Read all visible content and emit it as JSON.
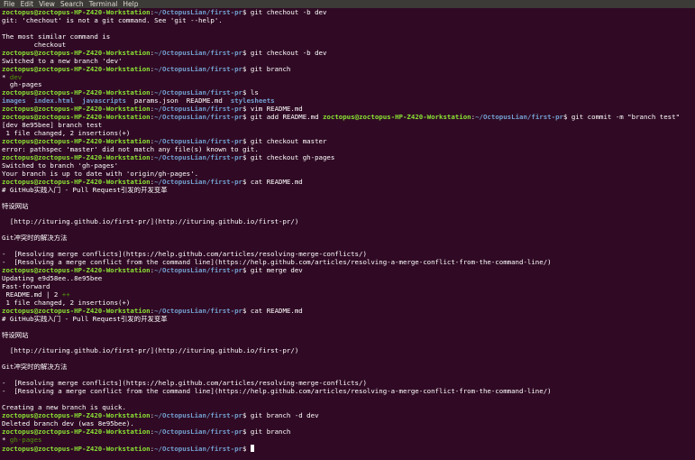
{
  "menu": [
    "File",
    "Edit",
    "View",
    "Search",
    "Terminal",
    "Help"
  ],
  "prompt": {
    "user": "zoctopus@zoctopus-HP-Z420-Workstation",
    "path": "~/OctopusLian/first-pr",
    "sym": "$ "
  },
  "lines": [
    {
      "t": "cmd",
      "cmd": "git chechout -b dev"
    },
    {
      "t": "out",
      "text": "git: 'chechout' is not a git command. See 'git --help'."
    },
    {
      "t": "out",
      "text": ""
    },
    {
      "t": "out",
      "text": "The most similar command is"
    },
    {
      "t": "out",
      "text": "        checkout"
    },
    {
      "t": "cmd",
      "cmd": "git checkout -b dev"
    },
    {
      "t": "out",
      "text": "Switched to a new branch 'dev'"
    },
    {
      "t": "cmd",
      "cmd": "git branch"
    },
    {
      "t": "branch",
      "star": "* ",
      "text": "dev"
    },
    {
      "t": "out",
      "text": "  gh-pages"
    },
    {
      "t": "cmd",
      "cmd": "ls"
    },
    {
      "t": "ls",
      "items": [
        {
          "text": "images",
          "k": "dir"
        },
        {
          "text": "index.html",
          "k": "dir"
        },
        {
          "text": "javascripts",
          "k": "dir"
        },
        {
          "text": "params.json",
          "k": "file"
        },
        {
          "text": "README.md",
          "k": "file"
        },
        {
          "text": "stylesheets",
          "k": "dir"
        }
      ]
    },
    {
      "t": "cmd",
      "cmd": "vim README.md"
    },
    {
      "t": "cmd2",
      "cmd": "git add README.md ",
      "cmd2": "git commit -m \"branch test\""
    },
    {
      "t": "out",
      "text": "[dev 8e95bee] branch test"
    },
    {
      "t": "out",
      "text": " 1 file changed, 2 insertions(+)"
    },
    {
      "t": "cmd",
      "cmd": "git checkout master"
    },
    {
      "t": "out",
      "text": "error: pathspec 'master' did not match any file(s) known to git."
    },
    {
      "t": "cmd",
      "cmd": "git checkout gh-pages"
    },
    {
      "t": "out",
      "text": "Switched to branch 'gh-pages'"
    },
    {
      "t": "out",
      "text": "Your branch is up to date with 'origin/gh-pages'."
    },
    {
      "t": "cmd",
      "cmd": "cat README.md"
    },
    {
      "t": "out",
      "text": "# GitHub实践入门 - Pull Request引发的开发变革"
    },
    {
      "t": "out",
      "text": ""
    },
    {
      "t": "out",
      "text": "特设网站"
    },
    {
      "t": "out",
      "text": ""
    },
    {
      "t": "out",
      "text": "  [http://ituring.github.io/first-pr/](http://ituring.github.io/first-pr/)"
    },
    {
      "t": "out",
      "text": ""
    },
    {
      "t": "out",
      "text": "Git冲突时的解决方法"
    },
    {
      "t": "out",
      "text": ""
    },
    {
      "t": "out",
      "text": "-  [Resolving merge conflicts](https://help.github.com/articles/resolving-merge-conflicts/)"
    },
    {
      "t": "out",
      "text": "-  [Resolving a merge conflict from the command line](https://help.github.com/articles/resolving-a-merge-conflict-from-the-command-line/)"
    },
    {
      "t": "cmd",
      "cmd": "git merge dev"
    },
    {
      "t": "out",
      "text": "Updating e9d58ee..8e95bee"
    },
    {
      "t": "out",
      "text": "Fast-forward"
    },
    {
      "t": "stat",
      "text": " README.md | 2 ",
      "plus": "++"
    },
    {
      "t": "out",
      "text": " 1 file changed, 2 insertions(+)"
    },
    {
      "t": "cmd",
      "cmd": "cat README.md"
    },
    {
      "t": "out",
      "text": "# GitHub实践入门 - Pull Request引发的开发变革"
    },
    {
      "t": "out",
      "text": ""
    },
    {
      "t": "out",
      "text": "特设网站"
    },
    {
      "t": "out",
      "text": ""
    },
    {
      "t": "out",
      "text": "  [http://ituring.github.io/first-pr/](http://ituring.github.io/first-pr/)"
    },
    {
      "t": "out",
      "text": ""
    },
    {
      "t": "out",
      "text": "Git冲突时的解决方法"
    },
    {
      "t": "out",
      "text": ""
    },
    {
      "t": "out",
      "text": "-  [Resolving merge conflicts](https://help.github.com/articles/resolving-merge-conflicts/)"
    },
    {
      "t": "out",
      "text": "-  [Resolving a merge conflict from the command line](https://help.github.com/articles/resolving-a-merge-conflict-from-the-command-line/)"
    },
    {
      "t": "out",
      "text": ""
    },
    {
      "t": "out",
      "text": "Creating a new branch is quick."
    },
    {
      "t": "cmd",
      "cmd": "git branch -d dev"
    },
    {
      "t": "out",
      "text": "Deleted branch dev (was 8e95bee)."
    },
    {
      "t": "cmd",
      "cmd": "git branch"
    },
    {
      "t": "branch",
      "star": "* ",
      "text": "gh-pages"
    },
    {
      "t": "cursor",
      "cmd": ""
    }
  ],
  "colors": {
    "background": "#300a24",
    "user": "#8ae234",
    "path": "#729fcf",
    "branch": "#4e9a06",
    "directory": "#729fcf"
  }
}
